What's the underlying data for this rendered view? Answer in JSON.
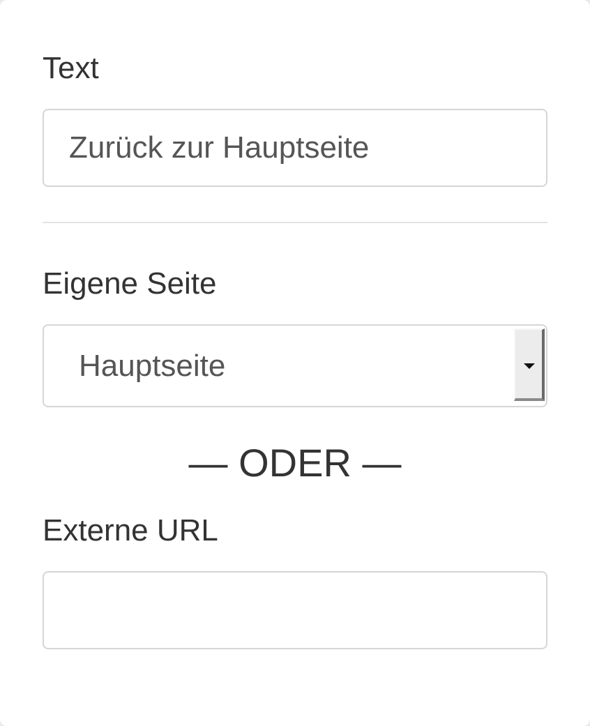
{
  "form": {
    "text_label": "Text",
    "text_value": "Zurück zur Hauptseite",
    "page_label": "Eigene Seite",
    "page_selected": "Hauptseite",
    "separator": "— ODER —",
    "url_label": "Externe URL",
    "url_value": ""
  },
  "colors": {
    "label": "#333333",
    "input_text": "#555555",
    "border": "#d6d6d6",
    "background": "#ffffff"
  }
}
